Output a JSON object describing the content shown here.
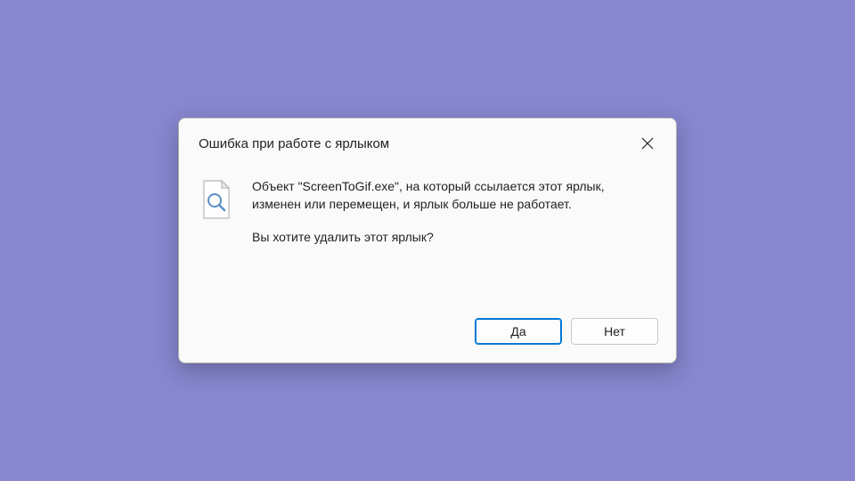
{
  "dialog": {
    "title": "Ошибка при работе с ярлыком",
    "message_main": "Объект \"ScreenToGif.exe\", на который ссылается этот ярлык, изменен или перемещен, и ярлык больше не работает.",
    "message_question": "Вы хотите удалить этот ярлык?",
    "buttons": {
      "yes": "Да",
      "no": "Нет"
    }
  }
}
